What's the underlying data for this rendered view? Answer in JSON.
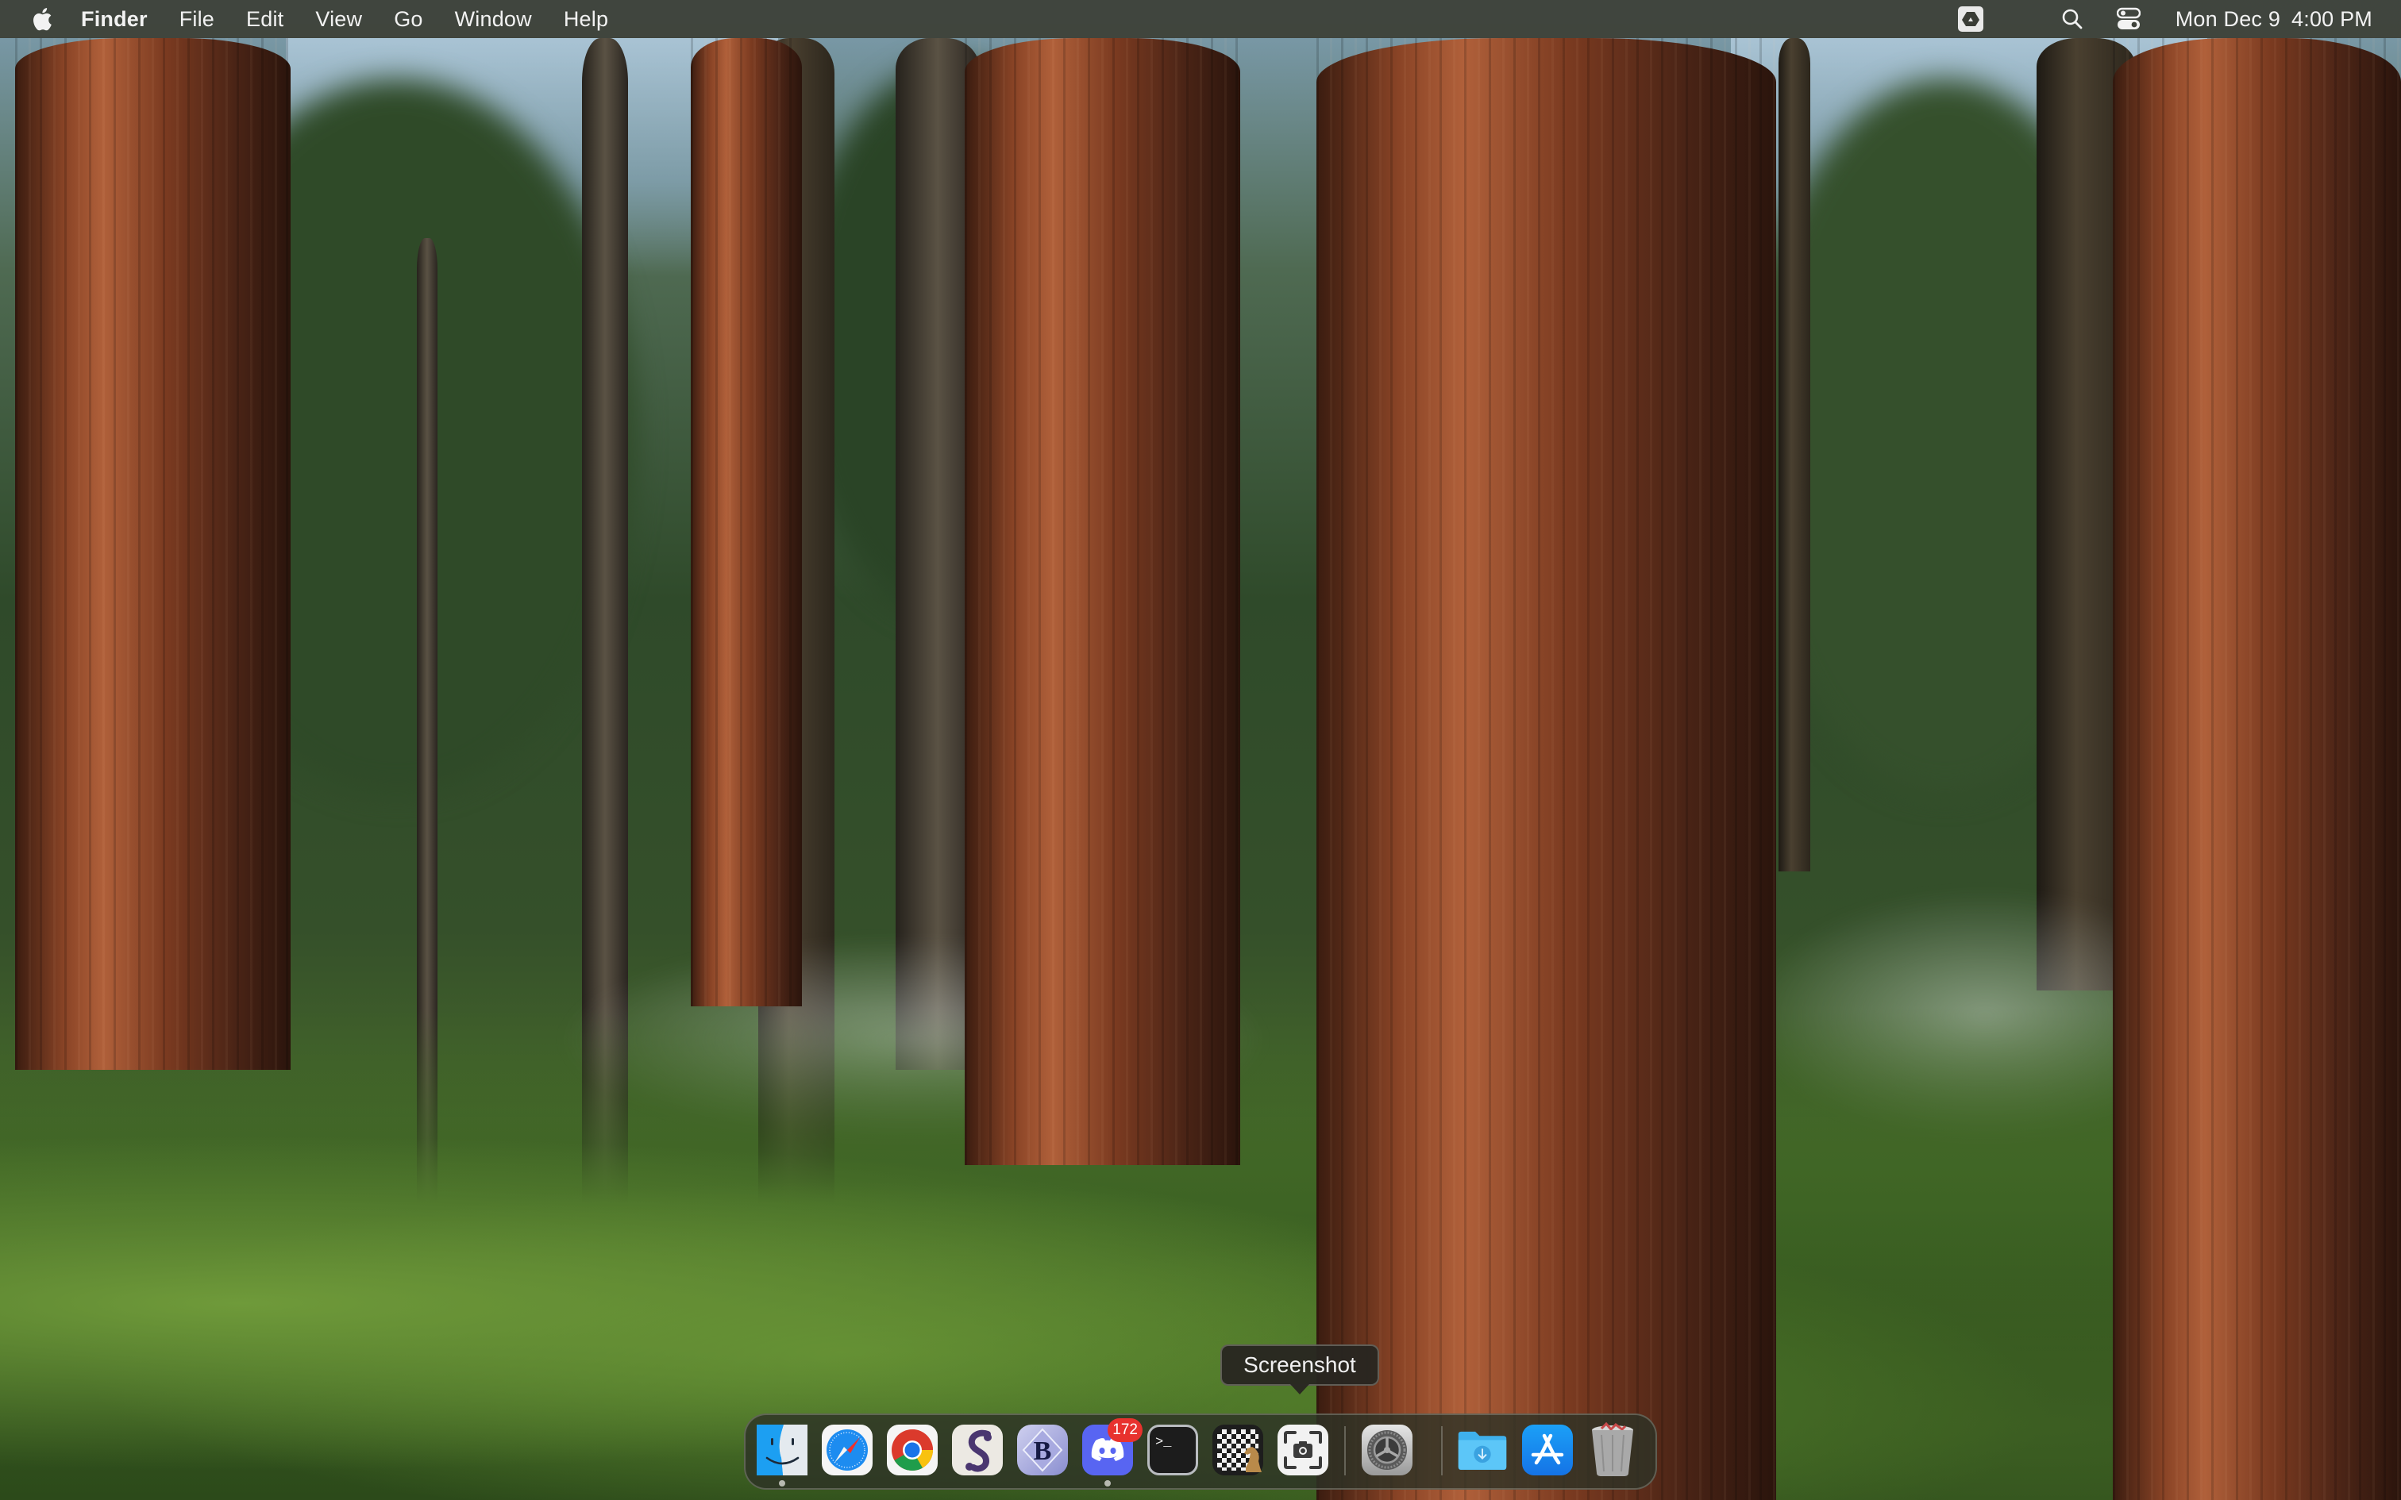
{
  "menubar": {
    "apple_icon": "apple-logo-icon",
    "app_name": "Finder",
    "menus": [
      "File",
      "Edit",
      "View",
      "Go",
      "Window",
      "Help"
    ],
    "status_icons": [
      "google-drive-icon",
      "spotlight-search-icon",
      "control-center-icon"
    ],
    "date": "Mon Dec 9",
    "time": "4:00 PM"
  },
  "tooltip": {
    "label": "Screenshot"
  },
  "dock": {
    "apps": [
      {
        "name": "Finder",
        "icon": "finder-icon",
        "running": true
      },
      {
        "name": "Safari",
        "icon": "safari-icon",
        "running": false
      },
      {
        "name": "Google Chrome",
        "icon": "chrome-icon",
        "running": false
      },
      {
        "name": "Scrivener",
        "icon": "scrivener-icon",
        "running": false
      },
      {
        "name": "BBEdit",
        "icon": "bbedit-icon",
        "running": false
      },
      {
        "name": "Discord",
        "icon": "discord-icon",
        "running": true,
        "badge": "172"
      },
      {
        "name": "Terminal",
        "icon": "terminal-icon",
        "running": false
      },
      {
        "name": "Chess",
        "icon": "chess-icon",
        "running": false
      },
      {
        "name": "Screenshot",
        "icon": "screenshot-icon",
        "running": false
      }
    ],
    "system": [
      {
        "name": "System Settings",
        "icon": "system-settings-icon"
      }
    ],
    "stacks": [
      {
        "name": "Downloads",
        "icon": "downloads-folder-icon"
      },
      {
        "name": "App Store",
        "icon": "app-store-icon"
      },
      {
        "name": "Trash",
        "icon": "trash-icon"
      }
    ]
  },
  "wallpaper": {
    "description": "Giant sequoia forest"
  }
}
